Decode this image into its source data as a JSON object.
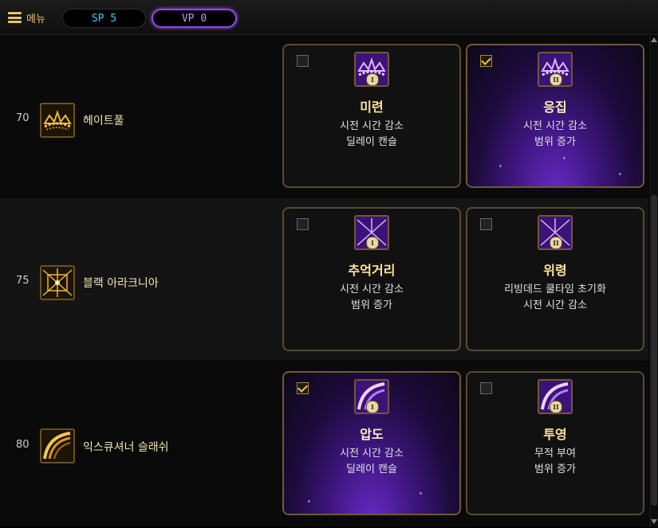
{
  "topbar": {
    "menu_label": "메뉴",
    "sp_label": "SP 5",
    "vp_label": "VP 0"
  },
  "rows": [
    {
      "level": "70",
      "skill_name": "헤이트풀",
      "icon": "chain-crown-icon",
      "cards": [
        {
          "title": "미련",
          "line1": "시전 시간 감소",
          "line2": "딜레이 캔슬",
          "checked": false,
          "roman": "I"
        },
        {
          "title": "응집",
          "line1": "시전 시간 감소",
          "line2": "범위 증가",
          "checked": true,
          "roman": "II"
        }
      ]
    },
    {
      "level": "75",
      "skill_name": "블랙 아라크니아",
      "icon": "spider-web-icon",
      "cards": [
        {
          "title": "추억거리",
          "line1": "시전 시간 감소",
          "line2": "범위 증가",
          "checked": false,
          "roman": "I"
        },
        {
          "title": "위령",
          "line1": "리빙데드 쿨타임 초기화",
          "line2": "시전 시간 감소",
          "checked": false,
          "roman": "II"
        }
      ]
    },
    {
      "level": "80",
      "skill_name": "익스큐셔너 슬래쉬",
      "icon": "scythe-slash-icon",
      "cards": [
        {
          "title": "압도",
          "line1": "시전 시간 감소",
          "line2": "딜레이 캔슬",
          "checked": true,
          "roman": "I"
        },
        {
          "title": "투영",
          "line1": "무적 부여",
          "line2": "범위 증가",
          "checked": false,
          "roman": "II"
        }
      ]
    }
  ],
  "colors": {
    "gold": "#e8c46a",
    "sp": "#45c9ff",
    "vp": "#c98cff",
    "selected_bg": "#5a22b0"
  }
}
